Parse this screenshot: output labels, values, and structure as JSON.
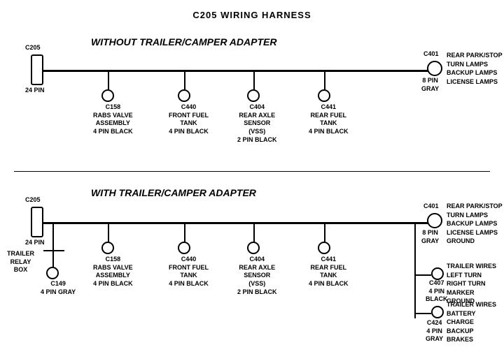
{
  "title": "C205 WIRING HARNESS",
  "section1": {
    "label": "WITHOUT  TRAILER/CAMPER  ADAPTER",
    "connectors": [
      {
        "id": "C205_top",
        "label": "C205",
        "sublabel": "24 PIN"
      },
      {
        "id": "C401_top",
        "label": "C401",
        "sublabel": "8 PIN\nGRAY"
      },
      {
        "id": "C158_top",
        "label": "C158",
        "sublabel": "RABS VALVE\nASSEMBLY\n4 PIN BLACK"
      },
      {
        "id": "C440_top",
        "label": "C440",
        "sublabel": "FRONT FUEL\nTANK\n4 PIN BLACK"
      },
      {
        "id": "C404_top",
        "label": "C404",
        "sublabel": "REAR AXLE\nSENSOR\n(VSS)\n2 PIN BLACK"
      },
      {
        "id": "C441_top",
        "label": "C441",
        "sublabel": "REAR FUEL\nTANK\n4 PIN BLACK"
      }
    ],
    "right_label": "REAR PARK/STOP\nTURN LAMPS\nBACKUP LAMPS\nLICENSE LAMPS"
  },
  "section2": {
    "label": "WITH  TRAILER/CAMPER  ADAPTER",
    "connectors": [
      {
        "id": "C205_bot",
        "label": "C205",
        "sublabel": "24 PIN"
      },
      {
        "id": "C401_bot",
        "label": "C401",
        "sublabel": "8 PIN\nGRAY"
      },
      {
        "id": "C158_bot",
        "label": "C158",
        "sublabel": "RABS VALVE\nASSEMBLY\n4 PIN BLACK"
      },
      {
        "id": "C440_bot",
        "label": "C440",
        "sublabel": "FRONT FUEL\nTANK\n4 PIN BLACK"
      },
      {
        "id": "C404_bot",
        "label": "C404",
        "sublabel": "REAR AXLE\nSENSOR\n(VSS)\n2 PIN BLACK"
      },
      {
        "id": "C441_bot",
        "label": "C441",
        "sublabel": "REAR FUEL\nTANK\n4 PIN BLACK"
      },
      {
        "id": "C149",
        "label": "C149",
        "sublabel": "4 PIN GRAY"
      },
      {
        "id": "C407",
        "label": "C407",
        "sublabel": "4 PIN\nBLACK"
      },
      {
        "id": "C424",
        "label": "C424",
        "sublabel": "4 PIN\nGRAY"
      }
    ],
    "right_labels": [
      "REAR PARK/STOP\nTURN LAMPS\nBACKUP LAMPS\nLICENSE LAMPS\nGROUND",
      "TRAILER WIRES\nLEFT TURN\nRIGHT TURN\nMARKER\nGROUND",
      "TRAILER WIRES\nBATTERY CHARGE\nBACKUP\nBRAKES"
    ],
    "trailer_relay_label": "TRAILER\nRELAY\nBOX"
  }
}
